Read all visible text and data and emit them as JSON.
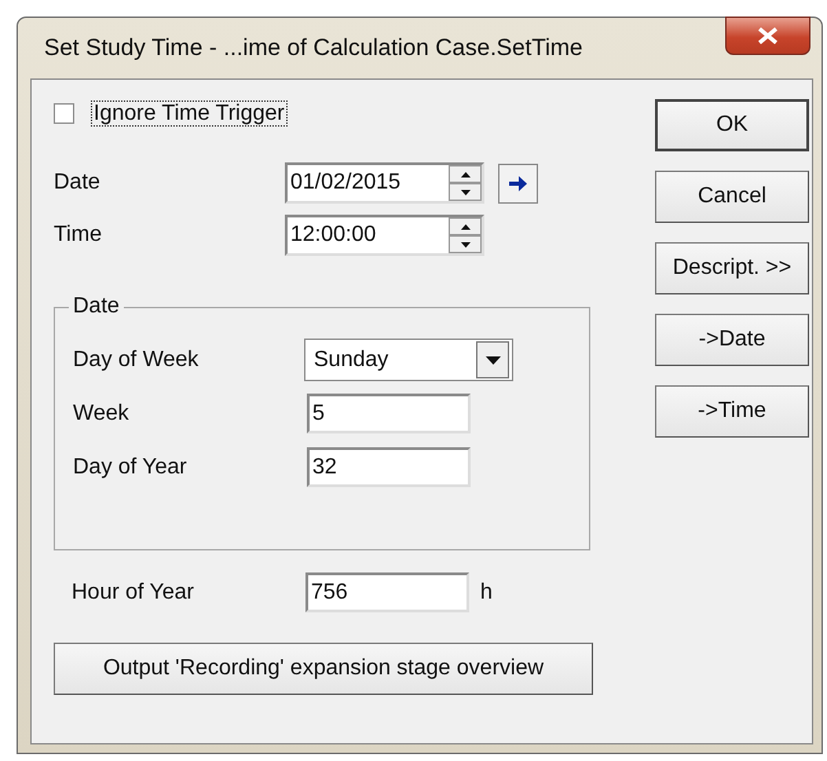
{
  "window": {
    "title": "Set Study Time - ...ime of Calculation Case.SetTime"
  },
  "ignore_time_trigger": {
    "label": "Ignore Time Trigger",
    "checked": false
  },
  "date": {
    "label": "Date",
    "value": "01/02/2015"
  },
  "time": {
    "label": "Time",
    "value": "12:00:00"
  },
  "date_group": {
    "title": "Date",
    "day_of_week": {
      "label": "Day of Week",
      "value": "Sunday"
    },
    "week": {
      "label": "Week",
      "value": "5"
    },
    "day_of_year": {
      "label": "Day of Year",
      "value": "32"
    }
  },
  "hour_of_year": {
    "label": "Hour of Year",
    "value": "756",
    "unit": "h"
  },
  "output_button": "Output 'Recording' expansion stage overview",
  "buttons": [
    {
      "label": "OK",
      "default": true
    },
    {
      "label": "Cancel",
      "default": false
    },
    {
      "label": "Descript. >>",
      "default": false
    },
    {
      "label": "->Date",
      "default": false
    },
    {
      "label": "->Time",
      "default": false
    }
  ]
}
